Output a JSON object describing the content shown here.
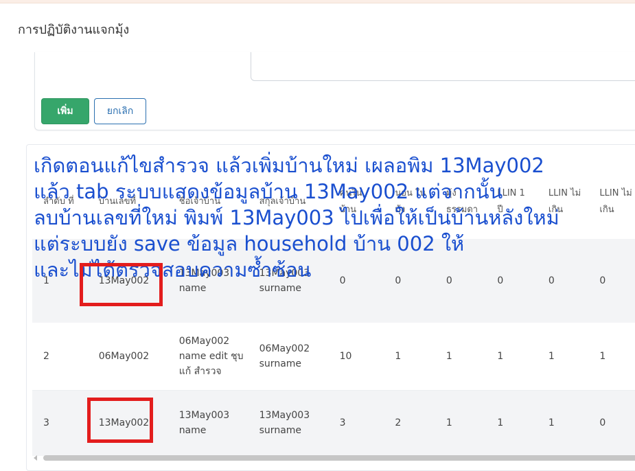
{
  "page": {
    "title": "การปฏิบัติงานแจกมุ้ง"
  },
  "form": {
    "add_label": "เพิ่ม",
    "cancel_label": "ยกเลิก"
  },
  "table": {
    "headers": [
      "ลำดับ ที่",
      "บ้านเลขที่",
      "ชื่อเจ้าบ้าน",
      "สกุลเจ้าบ้าน",
      "คนใน บ้าน",
      "นอน ใน มุ้ง",
      "มุ้ง ธรรมดา",
      "LLIN 1 ปี",
      "LLIN ไม่ เกิน",
      "LLIN ไม่ เกิน"
    ],
    "rows": [
      [
        "1",
        "13May002",
        "13May003 name",
        "13May003 surname",
        "0",
        "0",
        "0",
        "0",
        "0",
        "0"
      ],
      [
        "2",
        "06May002",
        "06May002 name edit ชุบ แก้ สำรวจ",
        "06May002 surname",
        "10",
        "1",
        "1",
        "1",
        "1",
        "1"
      ],
      [
        "3",
        "13May002",
        "13May003 name",
        "13May003 surname",
        "3",
        "2",
        "1",
        "1",
        "1",
        "0"
      ]
    ]
  },
  "annotation": {
    "lines": [
      "เกิดตอนแก้ไขสำรวจ แล้วเพิ่มบ้านใหม่ เผลอพิม 13May002",
      "แล้ว tab ระบบแสดงข้อมูลบ้าน 13May002 แต่จากนั้น",
      "ลบบ้านเลขที่ใหม่ พิมพ์ 13May003 ไปเพื่อให้เป็นบ้านหลังใหม่",
      "แต่ระบบยัง save ข้อมูล household บ้าน 002 ให้",
      "และไม่ได้ตรวจสอบความซ้ำซ้อน"
    ]
  },
  "colors": {
    "add_button": "#36a66b",
    "cancel_border": "#2a6fb0",
    "annotation_text": "#1a4fcf",
    "highlight_box": "#e31d1d"
  }
}
